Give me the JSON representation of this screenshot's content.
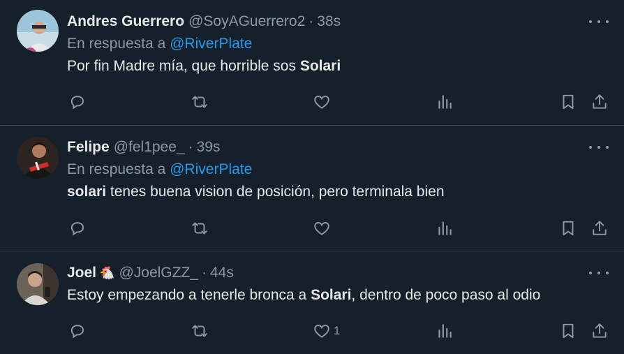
{
  "tweets": [
    {
      "name": "Andres Guerrero",
      "handle": "@SoyAGuerrero2",
      "time": "38s",
      "reply_prefix": "En respuesta a",
      "reply_to": "@RiverPlate",
      "text_before": "Por fin Madre mía, que horrible sos ",
      "text_bold": "Solari",
      "text_after": "",
      "likes": "",
      "avatar_color": "#6aa7c8"
    },
    {
      "name": "Felipe",
      "handle": "@fel1pee_",
      "time": "39s",
      "reply_prefix": "En respuesta a",
      "reply_to": "@RiverPlate",
      "text_before": "",
      "text_bold": "solari",
      "text_after": " tenes buena vision de posición, pero terminala bien",
      "likes": "",
      "avatar_color": "#3a2a28"
    },
    {
      "name": "Joel",
      "emoji": "🐔",
      "handle": "@JoelGZZ_",
      "time": "44s",
      "text_before": "Estoy empezando a tenerle bronca a ",
      "text_bold": "Solari",
      "text_after": ", dentro de poco paso al odio",
      "likes": "1",
      "avatar_color": "#5a5048"
    }
  ],
  "separator": "·",
  "icons": [
    "more-icon",
    "reply-icon",
    "retweet-icon",
    "like-icon",
    "views-icon",
    "bookmark-icon",
    "share-icon"
  ],
  "colors": {
    "background": "#15202b",
    "text": "#e7e9ea",
    "secondary": "#8b98a5",
    "link": "#1d9bf0",
    "divider": "#38444d"
  }
}
